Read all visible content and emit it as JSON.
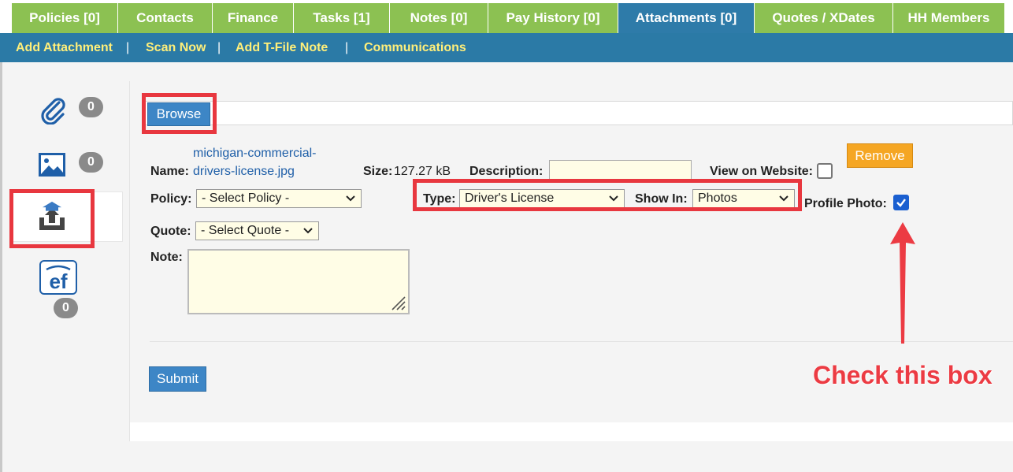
{
  "tabs": [
    {
      "label": "Policies [0]"
    },
    {
      "label": "Contacts"
    },
    {
      "label": "Finance"
    },
    {
      "label": "Tasks [1]"
    },
    {
      "label": "Notes [0]"
    },
    {
      "label": "Pay History [0]"
    },
    {
      "label": "Attachments [0]"
    },
    {
      "label": "Quotes / XDates"
    },
    {
      "label": "HH Members"
    }
  ],
  "subnav": {
    "add_attachment": "Add Attachment",
    "scan_now": "Scan Now",
    "add_tfile_note": "Add T-File Note",
    "communications": "Communications",
    "separator": "|"
  },
  "sidebar": {
    "attachments_count": "0",
    "images_count": "0",
    "ef_count": "0"
  },
  "form": {
    "browse_label": "Browse",
    "name_label": "Name:",
    "file_name_line1": "michigan-commercial-",
    "file_name_line2": "drivers-license.jpg",
    "size_label": "Size:",
    "size_value": "127.27 kB",
    "description_label": "Description:",
    "view_on_website_label": "View on Website:",
    "remove_label": "Remove",
    "policy_label": "Policy:",
    "policy_value": "- Select Policy -",
    "type_label": "Type:",
    "type_value": "Driver's License",
    "show_in_label": "Show In:",
    "show_in_value": "Photos",
    "profile_photo_label": "Profile Photo:",
    "quote_label": "Quote:",
    "quote_value": "- Select Quote -",
    "note_label": "Note:",
    "submit_label": "Submit"
  },
  "annotation": {
    "text": "Check this box"
  },
  "colors": {
    "tab_green": "#8cc152",
    "tab_active": "#2e7ba9",
    "subnav_bg": "#2b7aa6",
    "subnav_link": "#ffef7a",
    "highlight_red": "#e8373f"
  }
}
